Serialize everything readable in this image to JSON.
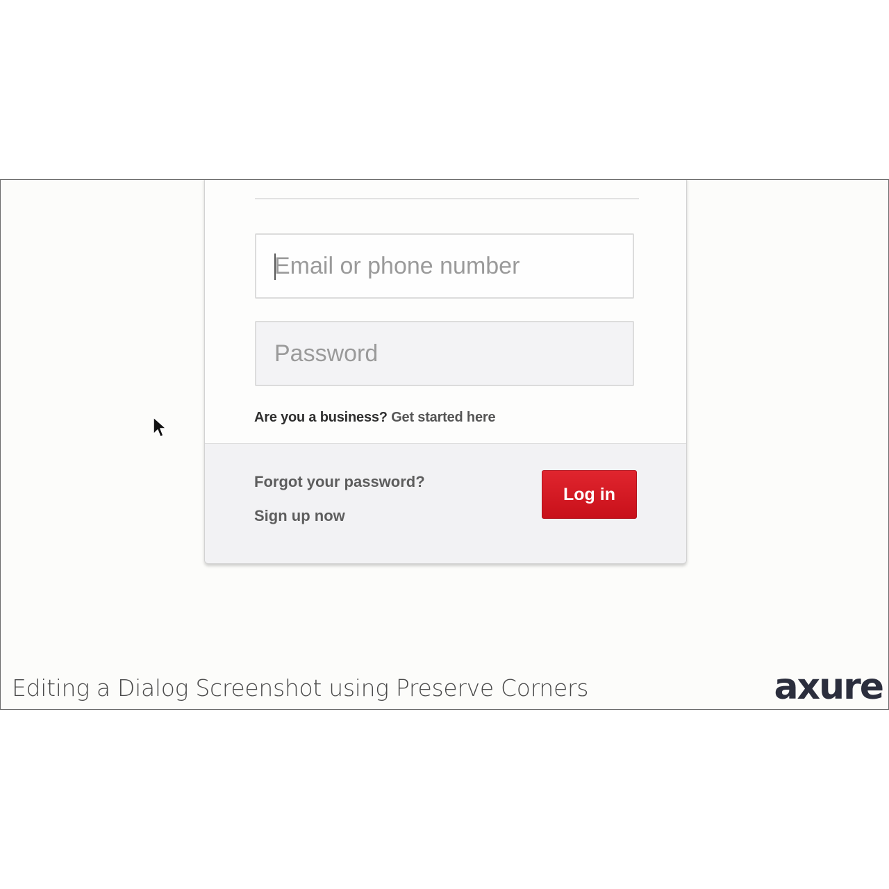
{
  "login_form": {
    "email_placeholder": "Email or phone number",
    "password_placeholder": "Password",
    "business_question": "Are you a business?",
    "business_link": "Get started here",
    "forgot_password": "Forgot your password?",
    "sign_up": "Sign up now",
    "login_button": "Log in"
  },
  "caption": {
    "text": "Editing a Dialog Screenshot using Preserve Corners"
  },
  "brand": {
    "logo": "axure"
  },
  "colors": {
    "primary_button": "#d41c25",
    "logo": "#2b2e3d"
  },
  "icons": {
    "cursor": "mouse-pointer-icon"
  }
}
